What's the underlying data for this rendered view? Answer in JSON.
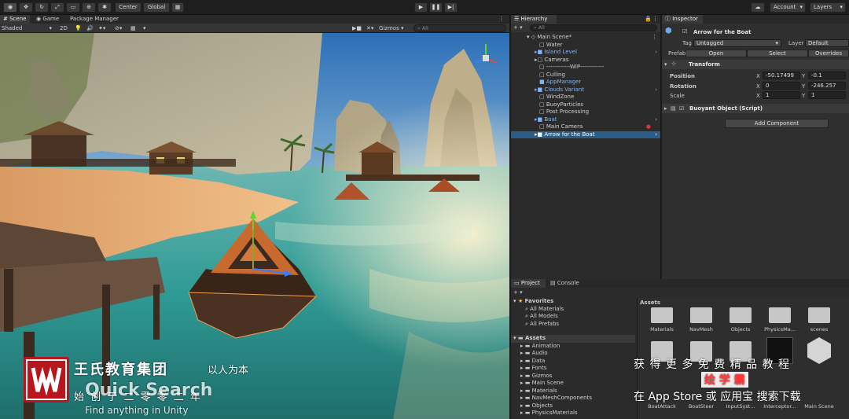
{
  "toolbar": {
    "pivot_center": "Center",
    "pivot_global": "Global",
    "account": "Account",
    "layers": "Layers"
  },
  "scene_panel": {
    "tabs": [
      "Scene",
      "Game",
      "Package Manager"
    ],
    "shading_mode": "Shaded",
    "mode_2d": "2D",
    "gizmos": "Gizmos",
    "search_placeholder": "All"
  },
  "hierarchy": {
    "tab": "Hierarchy",
    "search_placeholder": "All",
    "scene_name": "Main Scene*",
    "items": [
      {
        "label": "Water",
        "kind": "object"
      },
      {
        "label": "Island Level",
        "kind": "prefab"
      },
      {
        "label": "Cameras",
        "kind": "object"
      },
      {
        "label": "------------WIP------------",
        "kind": "object"
      },
      {
        "label": "Culling",
        "kind": "object"
      },
      {
        "label": "AppManager",
        "kind": "prefab"
      },
      {
        "label": "Clouds Variant",
        "kind": "prefab"
      },
      {
        "label": "WindZone",
        "kind": "object"
      },
      {
        "label": "BuoyParticles",
        "kind": "object"
      },
      {
        "label": "Post Processing",
        "kind": "object"
      },
      {
        "label": "Boat",
        "kind": "prefab"
      },
      {
        "label": "Main Camera",
        "kind": "object"
      },
      {
        "label": "Arrow for the Boat",
        "kind": "selected"
      }
    ]
  },
  "inspector": {
    "tab": "Inspector",
    "object_name": "Arrow for the Boat",
    "tag_label": "Tag",
    "tag_value": "Untagged",
    "layer_label": "Layer",
    "layer_value": "Default",
    "prefab_label": "Prefab",
    "prefab_open": "Open",
    "prefab_select": "Select",
    "prefab_overrides": "Overrides",
    "transform_title": "Transform",
    "position_label": "Position",
    "position_x": "-50.17499",
    "position_y": "-0.1",
    "rotation_label": "Rotation",
    "rotation_x": "0",
    "rotation_y": "-246.257",
    "scale_label": "Scale",
    "scale_x": "1",
    "scale_y": "1",
    "x_axis": "X",
    "y_axis": "Y",
    "script_title": "Buoyant Object (Script)",
    "add_component": "Add Component"
  },
  "project": {
    "tabs": [
      "Project",
      "Console"
    ],
    "favorites_title": "Favorites",
    "favorites": [
      "All Materials",
      "All Models",
      "All Prefabs"
    ],
    "assets_title": "Assets",
    "asset_folders": [
      "Animation",
      "Audio",
      "Data",
      "Fonts",
      "Gizmos",
      "Main Scene",
      "Materials",
      "NavMeshComponents",
      "Objects",
      "PhysicsMaterials"
    ],
    "grid_header": "Assets",
    "grid_row1": [
      "Materials",
      "NavMesh",
      "Objects",
      "PhysicsMa...",
      "scenes"
    ],
    "grid_row3": [
      "BoatAttack",
      "BoatSteer",
      "InputSyst...",
      "Interceptor...",
      "Main Scene"
    ]
  },
  "overlay": {
    "org_name": "王氏教育集团",
    "org_motto": "以人为本",
    "founded_text": "始 创 于 二 零 零 二 年",
    "quick_search_title": "Quick Search",
    "quick_search_subtitle": "Find anything in Unity",
    "promo_line1": "获 得 更 多 免 费 精 品 教 程",
    "promo_brand": "绘 学 霸",
    "promo_line2": "在 App Store 或 应用宝 搜索下载"
  },
  "colors": {
    "selection": "#2c5d87",
    "prefab_blue": "#7fb5f5",
    "logo_red": "#b8161c"
  }
}
